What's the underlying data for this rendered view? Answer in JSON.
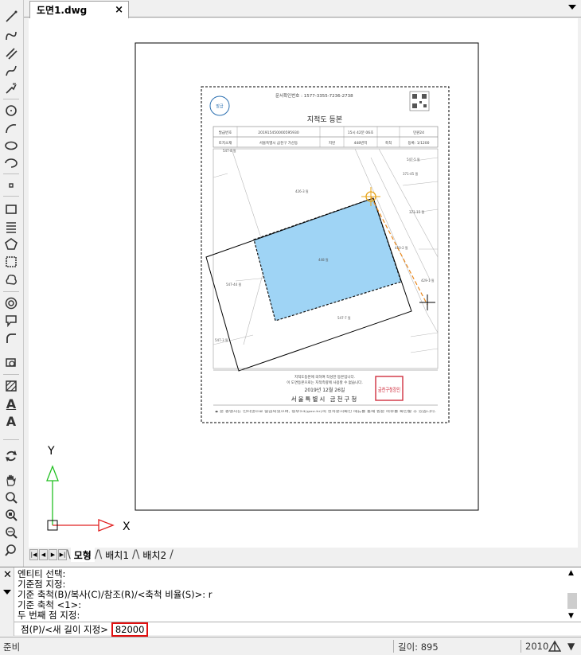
{
  "document_tab": {
    "title": "도면1.dwg",
    "close": "×"
  },
  "toolbar": {
    "items": [
      "line-icon",
      "polyline-icon",
      "double-line-icon",
      "arc-spline-icon",
      "freehand-icon",
      "circle-icon",
      "arc-icon",
      "ellipse-icon",
      "ellipse-arc-icon",
      "point-icon",
      "rectangle-icon",
      "helix-icon",
      "polygon-icon",
      "region-icon",
      "cloud-icon",
      "donut-icon",
      "callout-icon",
      "fillet-icon",
      "block-icon",
      "hatch-icon",
      "text-icon",
      "mtext-icon",
      "regen-icon",
      "pan-icon",
      "zoom-icon",
      "zoom-window-icon",
      "zoom-extents-icon",
      "zoom-realtime-icon"
    ],
    "text_a": "A",
    "text_b": "A"
  },
  "ucs": {
    "x_label": "X",
    "y_label": "Y"
  },
  "drawing": {
    "doc_number": "문서확인번호 : 1577-3355-7236-2738",
    "title": "지적도 등본",
    "header_labels": [
      "발급번호",
      "토지소재",
      "지번",
      "도면번호",
      "축척",
      "발급자"
    ],
    "header_values": [
      "201915450000595930",
      "서울특별시 금천구 가산동",
      "448번지",
      "15시 42분 06초",
      "등록: 1/1200",
      "민원24"
    ],
    "parcel_labels": [
      "547-8 필",
      "426-3 필",
      "547-5 필",
      "371-45 필",
      "371-15 필",
      "450-2 필",
      "429-1 필",
      "448 필",
      "547-44 필",
      "547-7 필",
      "547-3 필"
    ],
    "footer_line1": "지적도등본에 의하여 작성한 등본입니다.",
    "footer_line2": "이 도면등본으로는 지적측량에 사용할 수 없습니다.",
    "footer_date": "2019년 12월 26일",
    "footer_office": "서울특별시 금천구청",
    "footer_note": "◆ 본 증명서는 인터넷으로 발급되었으며, 정부24(gov.kr)의 전자문서확인 메뉴를 통해 원본 여부를 확인할 수 있습니다.",
    "seal_text": "금천구청장인"
  },
  "sheet_tabs": {
    "model": "모형",
    "layout1": "배치1",
    "layout2": "배치2"
  },
  "command": {
    "history": [
      "엔티티 선택:",
      "기준점 지정:",
      "기준 축척(B)/복사(C)/참조(R)/<축척 비율(S)>: r",
      "기준 축척 <1>:",
      "두 번째 점 지정:"
    ],
    "prompt": "점(P)/<새 길이 지정>",
    "input_value": "82000"
  },
  "status": {
    "ready": "준비",
    "length": "길이: 895",
    "version": "2010",
    "dropdown": "▼"
  },
  "colors": {
    "hatch": "#9fd4f5",
    "hatch_stroke": "#111111",
    "rubber_band": "#e8861a",
    "highlight": "#e01010",
    "ucs_y": "#22c022",
    "ucs_x": "#e02020"
  }
}
